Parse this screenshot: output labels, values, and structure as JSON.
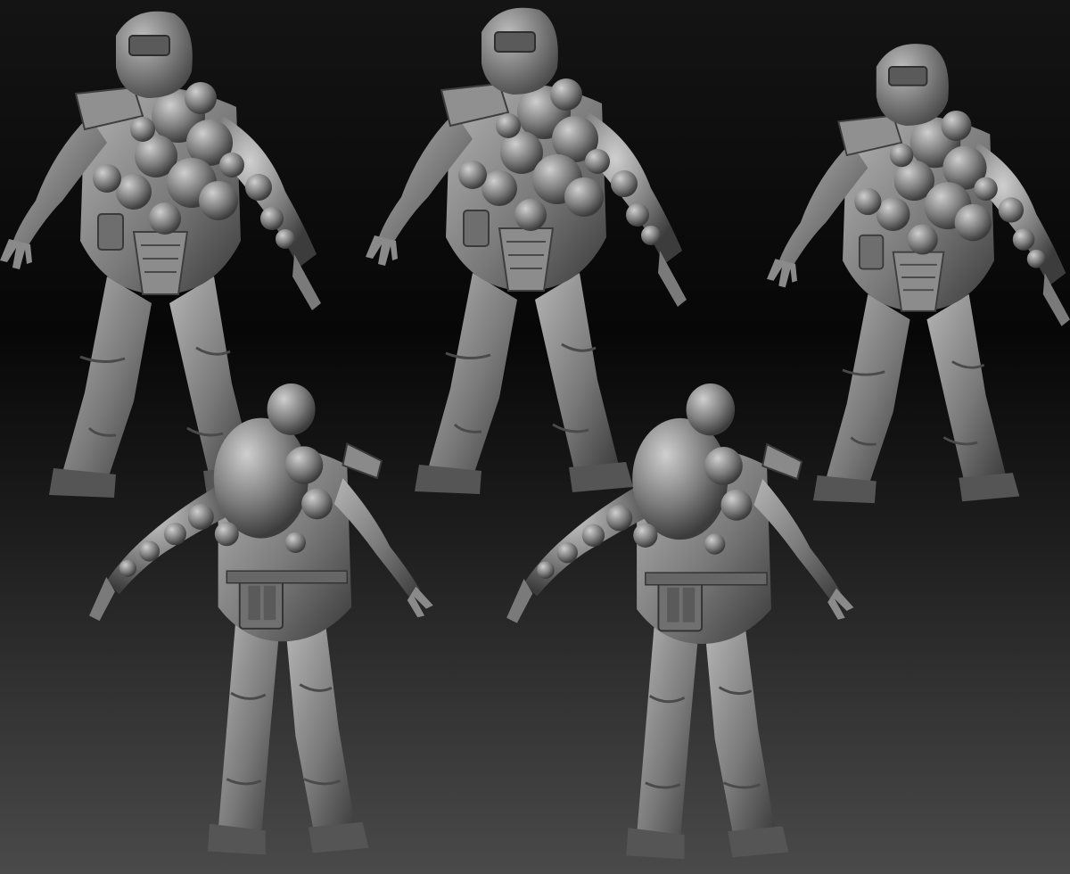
{
  "scene": {
    "subject": "sculpted-infected-welder-figure",
    "material": "matte-grey-clay",
    "views": [
      {
        "id": "front-left",
        "facing": "front"
      },
      {
        "id": "front-center",
        "facing": "front"
      },
      {
        "id": "front-right",
        "facing": "front"
      },
      {
        "id": "back-left",
        "facing": "back"
      },
      {
        "id": "back-right",
        "facing": "back"
      }
    ]
  },
  "colors": {
    "background_top": "#141414",
    "background_mid": "#070707",
    "background_bottom": "#4a4a4a",
    "clay_light": "#b4b4b4",
    "clay_mid": "#7a7a7a",
    "clay_dark": "#3a3a3a"
  }
}
